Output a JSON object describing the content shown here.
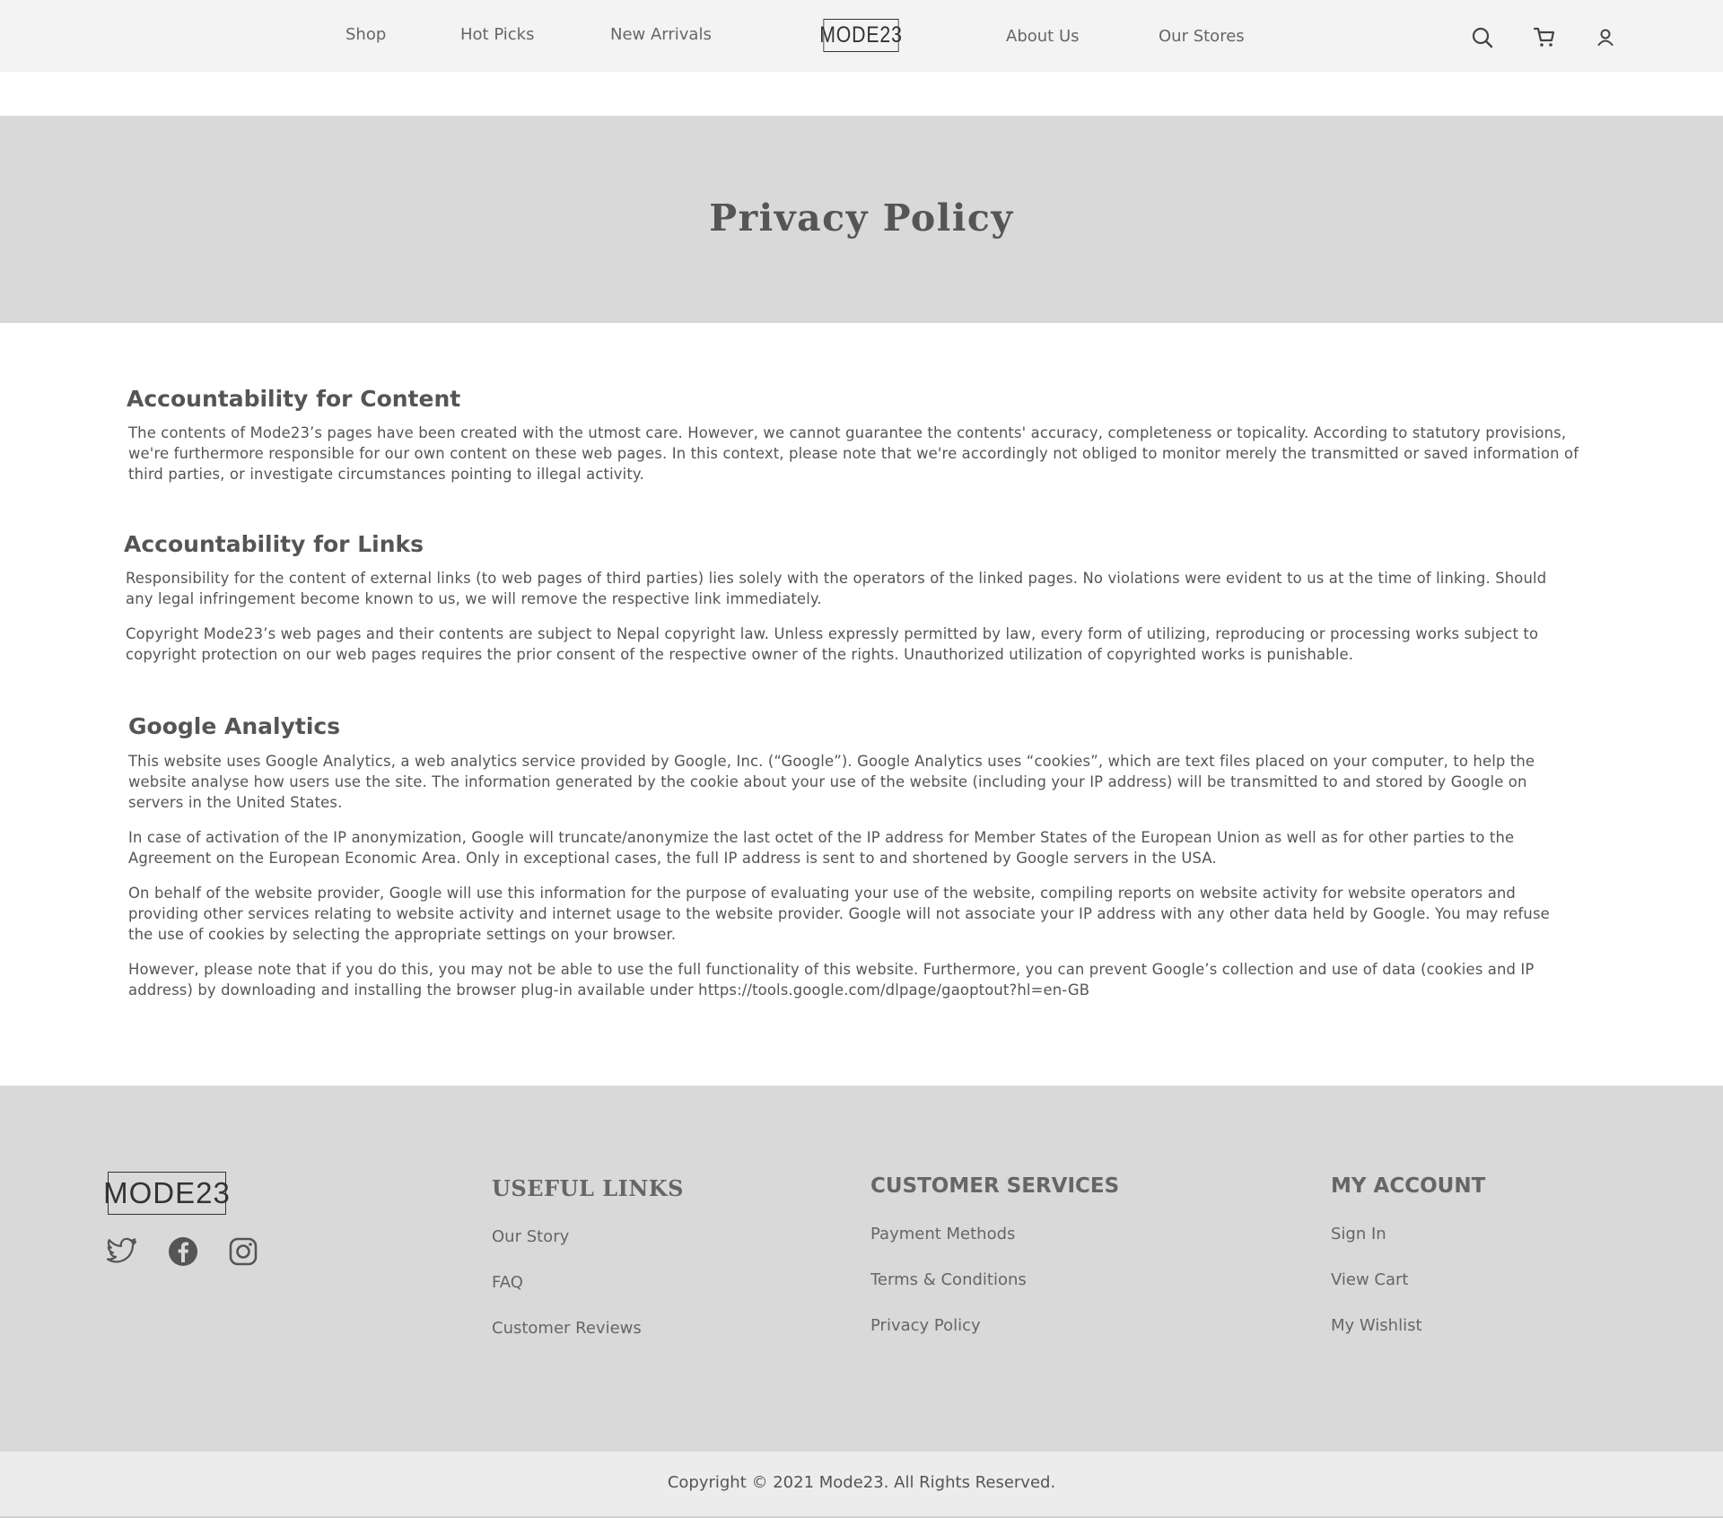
{
  "header": {
    "nav_left": [
      "Shop",
      "Hot Picks",
      "New Arrivals"
    ],
    "logo": "MODE23",
    "nav_right": [
      "About Us",
      "Our Stores"
    ],
    "icons": [
      "search-icon",
      "cart-icon",
      "user-icon"
    ]
  },
  "banner": {
    "title": "Privacy Policy"
  },
  "sections": [
    {
      "heading": "Accountability for Content",
      "paragraphs": [
        "The contents of Mode23’s pages have been created with the utmost care. However, we cannot guarantee the contents' accuracy, completeness or topicality. According to statutory provisions, we're furthermore responsible for our own content on these web pages. In this context, please note that we're accordingly not obliged to monitor merely the transmitted or saved information of third parties, or investigate circumstances pointing to illegal activity."
      ]
    },
    {
      "heading": "Accountability for Links",
      "paragraphs": [
        "Responsibility for the content of external links (to web pages of third parties) lies solely with the operators of the linked pages. No violations were evident to us at the time of linking. Should any legal infringement become known to us, we will remove the respective link immediately.",
        "Copyright Mode23’s web pages and their contents are subject to Nepal copyright law. Unless expressly permitted by law, every form of utilizing, reproducing or processing works subject to copyright protection on our web pages requires the prior consent of the respective owner of the rights. Unauthorized utilization of copyrighted works is punishable."
      ]
    },
    {
      "heading": "Google Analytics",
      "paragraphs": [
        "This website uses Google Analytics, a web analytics service provided by Google, Inc. (“Google”). Google Analytics uses “cookies”, which are text files placed on your computer, to help the website analyse how users use the site. The information generated by the cookie about your use of the website (including your IP address) will be transmitted to and stored by Google on servers in the United States.",
        "In case of activation of the IP anonymization, Google will truncate/anonymize the last octet of the IP address for Member States of the European Union as well as for other parties to the Agreement on the European Economic Area. Only in exceptional cases, the full IP address is sent to and shortened by Google servers in the USA.",
        "On behalf of the website provider, Google will use this information for the purpose of evaluating your use of the website, compiling reports on website activity for website operators and providing other services relating to website activity and internet usage to the website provider. Google will not associate your IP address with any other data held by Google. You may refuse the use of cookies by selecting the appropriate settings on your browser.",
        "However, please note that if you do this, you may not be able to use the full functionality of this website. Furthermore, you can prevent Google’s collection and use of data (cookies and IP address) by downloading and installing the browser plug-in available under https://tools.google.com/dlpage/gaoptout?hl=en-GB"
      ]
    }
  ],
  "footer": {
    "logo": "MODE23",
    "social_icons": [
      "twitter-icon",
      "facebook-icon",
      "instagram-icon"
    ],
    "columns": [
      {
        "heading": "USEFUL LINKS",
        "links": [
          "Our Story",
          "FAQ",
          "Customer Reviews"
        ]
      },
      {
        "heading": "CUSTOMER SERVICES",
        "links": [
          "Payment Methods",
          "Terms & Conditions",
          "Privacy Policy"
        ]
      },
      {
        "heading": "MY ACCOUNT",
        "links": [
          "Sign In",
          "View Cart",
          "My Wishlist"
        ]
      }
    ],
    "copyright": "Copyright © 2021 Mode23. All Rights Reserved."
  }
}
